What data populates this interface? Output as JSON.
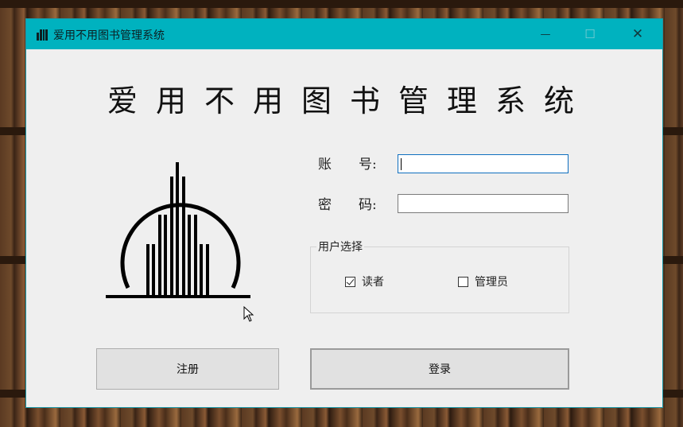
{
  "window": {
    "title": "爱用不用图书管理系统",
    "controls": {
      "minimize": "—",
      "maximize": "☐",
      "close": "✕"
    }
  },
  "heading": "爱用不用图书管理系统",
  "form": {
    "account_label": "账　　号:",
    "account_value": "",
    "password_label": "密　　码:",
    "password_value": ""
  },
  "user_select": {
    "legend": "用户选择",
    "options": [
      {
        "label": "读者",
        "checked": true
      },
      {
        "label": "管理员",
        "checked": false
      }
    ]
  },
  "buttons": {
    "register": "注册",
    "login": "登录"
  },
  "colors": {
    "titlebar": "#00b2bf",
    "focus_border": "#0f6fbf"
  }
}
